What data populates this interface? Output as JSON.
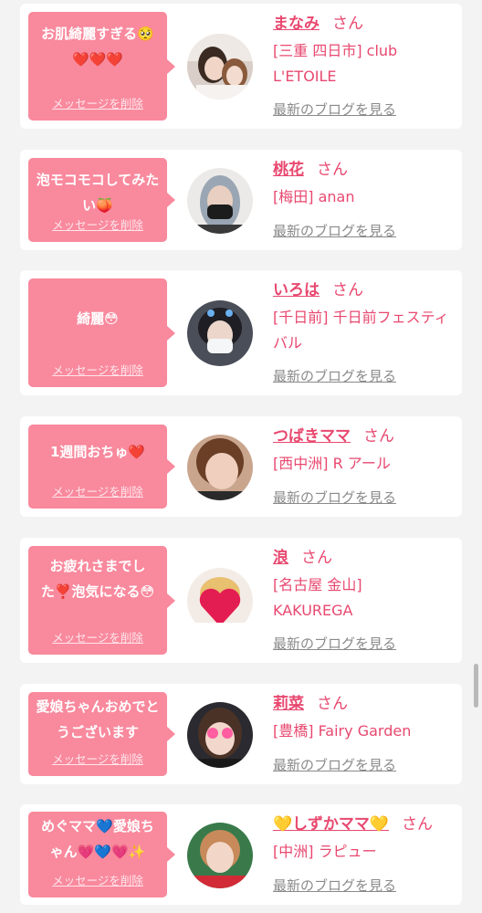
{
  "delete_label": "メッセージを削除",
  "san_label": "さん",
  "blog_label": "最新のブログを見る",
  "cards": [
    {
      "message": "お肌綺麗すぎる🥺❤️❤️❤️",
      "name": "まなみ",
      "shop": "[三重 四日市] club L'ETOILE",
      "avatar_icon": "woman-photo-avatar"
    },
    {
      "message": "泡モコモコしてみたい🍑",
      "name": "桃花",
      "shop": "[梅田] anan",
      "avatar_icon": "masked-woman-avatar"
    },
    {
      "message": "綺麗😳",
      "name": "いろは",
      "shop": "[千日前] 千日前フェスティバル",
      "avatar_icon": "masked-woman-avatar"
    },
    {
      "message": "1週間おちゅ❤️",
      "name": "つばきママ",
      "shop": "[西中洲] R アール",
      "avatar_icon": "woman-photo-avatar"
    },
    {
      "message": "お疲れさまでした❣️泡気になる😳",
      "name": "浪",
      "shop": "[名古屋 金山] KAKUREGA",
      "avatar_icon": "heart-covered-avatar"
    },
    {
      "message": "愛娘ちゃんおめでとうございます",
      "name": "莉菜",
      "shop": "[豊橋] Fairy Garden",
      "avatar_icon": "heart-eyes-avatar"
    },
    {
      "message": "めぐママ💙愛娘ちゃん💗💙💗✨",
      "name": "💛しずかママ💛",
      "shop": "[中洲] ラピュー",
      "avatar_icon": "woman-photo-avatar"
    }
  ]
}
